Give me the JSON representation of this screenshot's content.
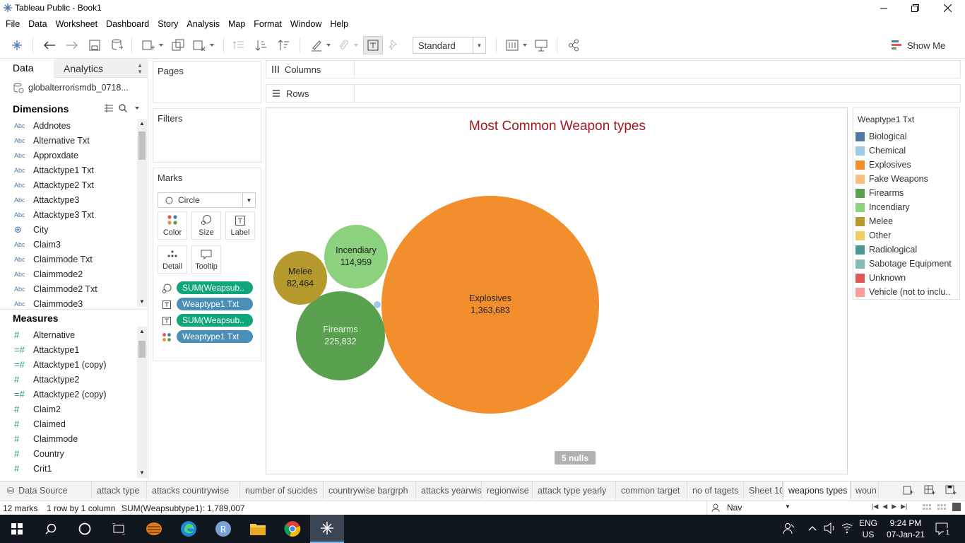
{
  "window": {
    "title": "Tableau Public - Book1"
  },
  "menu": [
    "File",
    "Data",
    "Worksheet",
    "Dashboard",
    "Story",
    "Analysis",
    "Map",
    "Format",
    "Window",
    "Help"
  ],
  "toolbar": {
    "fit_select": "Standard",
    "show_me": "Show Me"
  },
  "data_pane": {
    "tabs": [
      "Data",
      "Analytics"
    ],
    "datasource": "globalterrorismdb_0718...",
    "dimensions_title": "Dimensions",
    "dimensions": [
      {
        "type": "Abc",
        "name": "Addnotes"
      },
      {
        "type": "Abc",
        "name": "Alternative Txt"
      },
      {
        "type": "Abc",
        "name": "Approxdate"
      },
      {
        "type": "Abc",
        "name": "Attacktype1 Txt"
      },
      {
        "type": "Abc",
        "name": "Attacktype2 Txt"
      },
      {
        "type": "Abc",
        "name": "Attacktype3"
      },
      {
        "type": "Abc",
        "name": "Attacktype3 Txt"
      },
      {
        "type": "geo",
        "name": "City"
      },
      {
        "type": "Abc",
        "name": "Claim3"
      },
      {
        "type": "Abc",
        "name": "Claimmode Txt"
      },
      {
        "type": "Abc",
        "name": "Claimmode2"
      },
      {
        "type": "Abc",
        "name": "Claimmode2 Txt"
      },
      {
        "type": "Abc",
        "name": "Claimmode3"
      }
    ],
    "measures_title": "Measures",
    "measures": [
      {
        "type": "#",
        "name": "Alternative"
      },
      {
        "type": "=#",
        "name": "Attacktype1"
      },
      {
        "type": "=#",
        "name": "Attacktype1 (copy)"
      },
      {
        "type": "#",
        "name": "Attacktype2"
      },
      {
        "type": "=#",
        "name": "Attacktype2 (copy)"
      },
      {
        "type": "#",
        "name": "Claim2"
      },
      {
        "type": "#",
        "name": "Claimed"
      },
      {
        "type": "#",
        "name": "Claimmode"
      },
      {
        "type": "#",
        "name": "Country"
      },
      {
        "type": "#",
        "name": "Crit1"
      }
    ]
  },
  "cards": {
    "pages": "Pages",
    "filters": "Filters",
    "marks": "Marks",
    "mark_type": "Circle",
    "mark_buttons": [
      "Color",
      "Size",
      "Label",
      "Detail",
      "Tooltip"
    ],
    "pills": [
      {
        "icon": "size-icon",
        "label": "SUM(Weapsub..",
        "color": "#10a57a"
      },
      {
        "icon": "label-icon",
        "label": "Weaptype1 Txt",
        "color": "#4a8fb7"
      },
      {
        "icon": "label-icon",
        "label": "SUM(Weapsub..",
        "color": "#10a57a"
      },
      {
        "icon": "color-icon",
        "label": "Weaptype1 Txt",
        "color": "#4a8fb7"
      }
    ]
  },
  "shelves": {
    "columns": "Columns",
    "rows": "Rows"
  },
  "viz": {
    "nulls": "5 nulls"
  },
  "chart_data": {
    "type": "bubble",
    "title": "Most Common Weapon types",
    "series": [
      {
        "name": "Explosives",
        "value": 1363683,
        "label": "1,363,683",
        "color": "#f28e2b"
      },
      {
        "name": "Firearms",
        "value": 225832,
        "label": "225,832",
        "color": "#59a14f"
      },
      {
        "name": "Incendiary",
        "value": 114959,
        "label": "114,959",
        "color": "#8cd17d"
      },
      {
        "name": "Melee",
        "value": 82464,
        "label": "82,464",
        "color": "#b6992d"
      },
      {
        "name": "Chemical",
        "color": "#a0cbe8"
      }
    ],
    "legend_title": "Weaptype1 Txt",
    "legend_position": "right"
  },
  "legend": {
    "title": "Weaptype1 Txt",
    "items": [
      {
        "label": "Biological",
        "color": "#4e79a7"
      },
      {
        "label": "Chemical",
        "color": "#a0cbe8"
      },
      {
        "label": "Explosives",
        "color": "#f28e2b"
      },
      {
        "label": "Fake Weapons",
        "color": "#ffbe7d"
      },
      {
        "label": "Firearms",
        "color": "#59a14f"
      },
      {
        "label": "Incendiary",
        "color": "#8cd17d"
      },
      {
        "label": "Melee",
        "color": "#b6992d"
      },
      {
        "label": "Other",
        "color": "#f1ce63"
      },
      {
        "label": "Radiological",
        "color": "#499894"
      },
      {
        "label": "Sabotage Equipment",
        "color": "#86bcb6"
      },
      {
        "label": "Unknown",
        "color": "#e15759"
      },
      {
        "label": "Vehicle (not to inclu..",
        "color": "#ff9d9a"
      }
    ]
  },
  "sheet_tabs": [
    "Data Source",
    "attack type",
    "attacks countrywise",
    "number of sucides",
    "countrywise bargrph",
    "attacks yearwise",
    "regionwise",
    "attack type yearly",
    "common target",
    "no of tagets",
    "Sheet 10",
    "weapons types",
    "woun"
  ],
  "active_sheet": "weapons types",
  "status": {
    "marks": "12 marks",
    "dims": "1 row by 1 column",
    "sum": "SUM(Weapsubtype1): 1,789,007",
    "user": "Nav"
  },
  "taskbar": {
    "lang": "ENG",
    "region": "US",
    "time": "9:24 PM",
    "date": "07-Jan-21",
    "notif": "1"
  }
}
